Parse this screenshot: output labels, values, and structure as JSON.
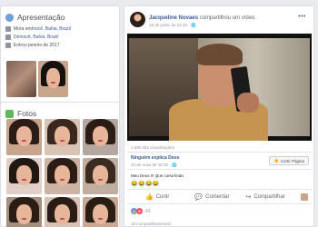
{
  "intro": {
    "title": "Apresentação",
    "rows": [
      {
        "prefix": "Mora em ",
        "link": "Inocê, Bahia, Brazil"
      },
      {
        "prefix": "De ",
        "link": "Inocê, Bahia, Brazil"
      },
      {
        "prefix": "Entrou janeiro de 2017",
        "link": ""
      }
    ]
  },
  "photos": {
    "title": "Fotos"
  },
  "post": {
    "author": "Jacqueline Novaes",
    "action": " compartilhou um vídeo.",
    "time": "16 de junho às 12:10 · ",
    "views": "1.660.052 visualizações",
    "shared_page": "Ninguém explica Deus",
    "shared_date": "23 de maio de 18:32 · ",
    "like_page_label": "Curtir Página",
    "caption": "Meu Deus !!! Que coisa linda",
    "emoji_line": "😂😂😂😂",
    "actions": {
      "like": "Curtir",
      "comment": "Comentar",
      "share": "Compartilhar"
    },
    "reaction_count": "43",
    "shares": "15 compartilhamentos"
  },
  "colors": {
    "link": "#385898",
    "page_bg": "#e9ebee",
    "like_blue": "#5890ff",
    "love_red": "#f25268"
  }
}
